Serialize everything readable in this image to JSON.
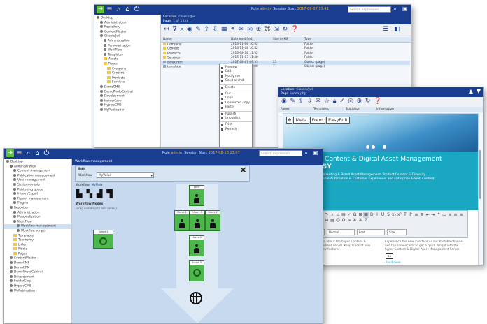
{
  "back_window": {
    "user_prefix": "Role",
    "user_name": "admin",
    "session_label": "Session Start",
    "session_time": "2017-08-07 13:41",
    "search_placeholder": "Search expression",
    "location_label": "Location",
    "location_value": "Classic/Jwl",
    "page_label": "Page",
    "page_value": "1 of 1 (x)",
    "tree": [
      "Desktop",
      "Administration",
      "Repository",
      "ContentMaster",
      "Classic/Jwl",
      "Administration",
      "Personalization",
      "WorkFlow",
      "Templates",
      "Assets",
      "Pages",
      "Company",
      "Content",
      "Products",
      "Services",
      "DemoCMS",
      "DemoPhotoCentral",
      "Development",
      "InsiderCorp",
      "HypersCMS",
      "MyPublication"
    ],
    "grid_headers": [
      "Name",
      "Date modified",
      "Size in KB",
      "Type"
    ],
    "rows": [
      {
        "name": "Company",
        "date": "2016-11-08 16:52",
        "size": "",
        "type": "Folder"
      },
      {
        "name": "Content",
        "date": "2016-11-08 16:52",
        "size": "",
        "type": "Folder"
      },
      {
        "name": "Products",
        "date": "2016-08-18 11:52",
        "size": "",
        "type": "Folder"
      },
      {
        "name": "Services",
        "date": "2016-11-03 11:40",
        "size": "",
        "type": "Folder"
      },
      {
        "name": "index.htm",
        "date": "2017-08-07 09:53",
        "size": "25",
        "type": "Object (page)"
      },
      {
        "name": "template",
        "date": "2017-07-17 12:00",
        "size": "7",
        "type": "Object (page)"
      }
    ],
    "context_menu": [
      "Preview",
      "Edit",
      "Notify me",
      "Send to chat",
      "Delete",
      "Cut",
      "Copy",
      "Connected copy",
      "Paste",
      "Publish",
      "Unpublish",
      "Print",
      "Refresh"
    ]
  },
  "left_window": {
    "user_prefix": "Role",
    "user_name": "admin",
    "session_label": "Session Start",
    "session_time": "2017-08-10 13:07",
    "search_placeholder": "Search expression",
    "header_title": "Workflow management",
    "edit_label": "Edit",
    "workflow_label": "Workflow",
    "workflow_value": "MyValue",
    "wf_title": "Workflow",
    "wf_name": "MyFlow",
    "nodes_title": "Workflow Nodes",
    "nodes_hint": "(drag and drop to add nodes)",
    "script_label": "Script 1",
    "tree": [
      "Desktop",
      "Administration",
      "Content management",
      "Publication management",
      "User management",
      "System events",
      "Publishing queue",
      "Import/Export",
      "Report management",
      "Plugins",
      "Repository",
      "Administration",
      "Personalization",
      "WorkFlow",
      "Workflow management",
      "Workflow scripts",
      "Templates",
      "Taxonomy",
      "Links",
      "Media",
      "Pages",
      "ContentMaster",
      "DemoCMS",
      "DemoCRM",
      "DemoPhotoCentral",
      "Development",
      "InsiderCorp",
      "HypersCMS",
      "MyPublication"
    ],
    "nodes": [
      {
        "label": "Start",
        "kind": "person"
      },
      {
        "label": "Users 1",
        "kind": "person"
      },
      {
        "label": "Users 2",
        "kind": "person"
      },
      {
        "label": "Users 3",
        "kind": "person"
      },
      {
        "label": "Users 4",
        "kind": "person"
      },
      {
        "label": "Script 3",
        "kind": "script"
      }
    ]
  },
  "right_window": {
    "location_label": "Location",
    "location_value": "Classic/Jwl",
    "page_label": "Page",
    "page_value": "index.php",
    "tabs": [
      "Pages",
      "Templates",
      "Statistics",
      "Information"
    ],
    "edit_tabs": [
      "Meta",
      "Form",
      "EasyEdit"
    ],
    "hero_title_1": "Enterprise Content & Digital Asset Management",
    "hero_title_2": "MADE EASY",
    "hero_text": "Our solutions cover Marketing & Brand Asset Management, Product Content & Diversity Management, Commerce Automation & Customer Experience, and Enterprise & Web Content Management.",
    "format_options": [
      "Styles",
      "Normal",
      "Font",
      "Size"
    ],
    "text_left": "News and Information about the hyper Content & Digital Asset Management Server. Keep track of new releases and their new features.",
    "text_right": "Experience the new interface as our Youtube channel. See the screencasts to get a quick insight into the hyper Content & Digital Asset Management Server.",
    "read_more": "Read more"
  },
  "colors": {
    "topbar": "#1a3d8f",
    "sidebar_bg": "#ffffff",
    "canvas_bg": "#c7d9ee",
    "node_green": "#4cb84c",
    "hero_teal": "#19a7c2"
  }
}
